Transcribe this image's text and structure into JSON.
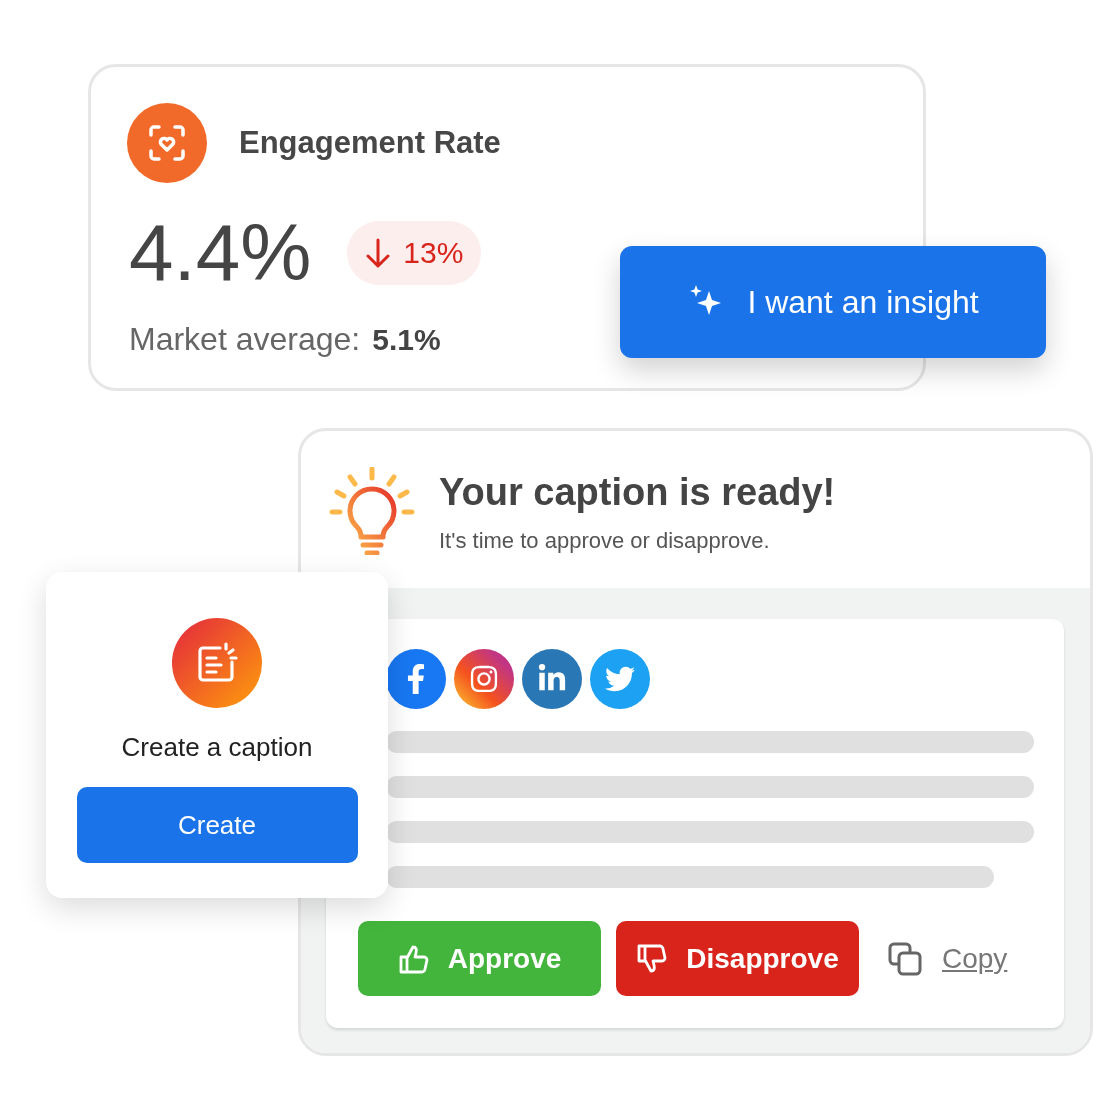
{
  "engagement_card": {
    "title": "Engagement Rate",
    "value": "4.4%",
    "change": {
      "text": "13%",
      "decrease": true
    },
    "market_label": "Market average:",
    "market_value": "5.1%"
  },
  "insight_button": {
    "label": "I want an insight"
  },
  "caption_card": {
    "title": "Your caption is ready!",
    "subtitle": "It's time to approve or disapprove.",
    "approve": "Approve",
    "disapprove": "Disapprove",
    "copy": "Copy"
  },
  "create_card": {
    "label": "Create a caption",
    "button": "Create"
  }
}
